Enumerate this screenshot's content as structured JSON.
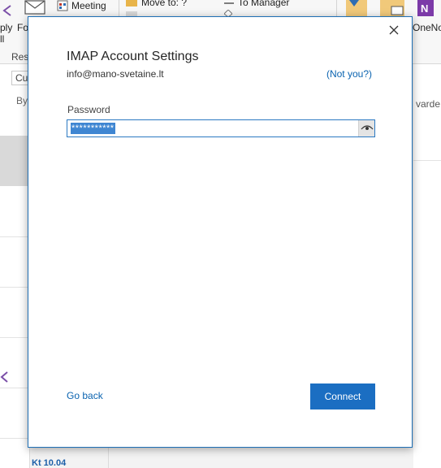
{
  "background": {
    "ribbon": {
      "reply_fragment": "ply",
      "reply_fragment2": "ll",
      "forward_fragment": "Fo",
      "meeting_label": "Meeting",
      "move_to_label": "Move to: ?",
      "to_manager_label": "To Manager",
      "onenote_label": "OneNo",
      "group_label": "Resp"
    },
    "left": {
      "current_fragment": "Cur",
      "by_fragment": "By"
    },
    "right": {
      "forwarded_fragment": "varde"
    },
    "list": {
      "date_label": "Kt 10.04"
    }
  },
  "dialog": {
    "title": "IMAP Account Settings",
    "email": "info@mano-svetaine.lt",
    "not_you": "(Not you?)",
    "password_label": "Password",
    "password_value": "***********",
    "go_back": "Go back",
    "connect": "Connect"
  },
  "colors": {
    "accent": "#1b6ec2",
    "link": "#0a63b0",
    "selection": "#3f86d2"
  },
  "icons": [
    "close-icon",
    "eye-icon",
    "reply-icon",
    "envelope-icon",
    "meeting-icon",
    "folder-icon",
    "onenote-icon"
  ]
}
